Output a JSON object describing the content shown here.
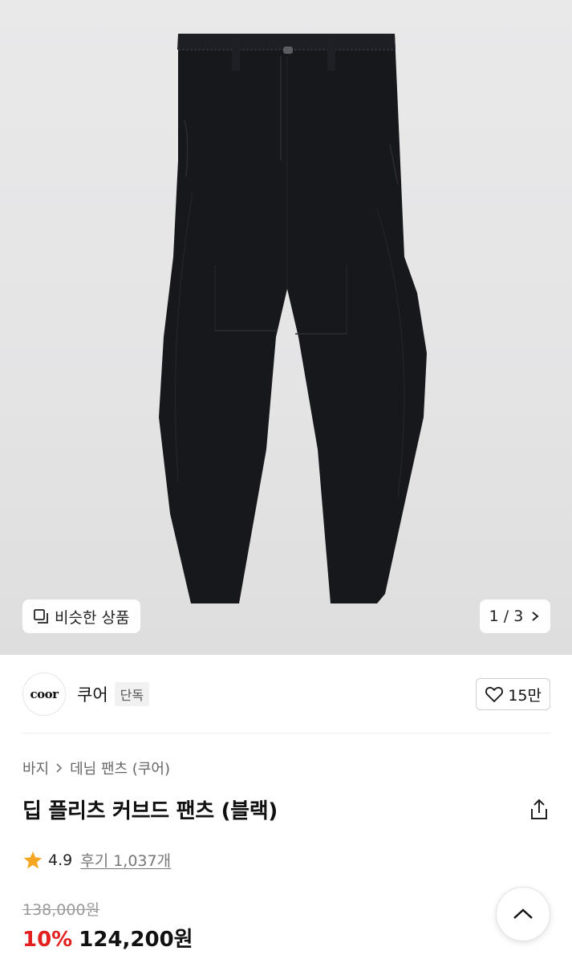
{
  "gallery": {
    "similar_label": "비슷한 상품",
    "current_page": 1,
    "total_pages": 3,
    "pager_text": "1 / 3"
  },
  "brand": {
    "logo_text": "coor",
    "name": "쿠어",
    "badge": "단독",
    "likes": "15만"
  },
  "breadcrumb": [
    "바지",
    "데님 팬츠 (쿠어)"
  ],
  "product": {
    "title": "딥 플리츠 커브드 팬츠 (블랙)",
    "rating": "4.9",
    "reviews": "후기 1,037개",
    "original_price": "138,000원",
    "discount": "10%",
    "sale_price": "124,200원"
  },
  "icons": {
    "similar": "stacked-squares-icon",
    "pager_next": "chevron-right-icon",
    "like": "heart-outline-icon",
    "breadcrumb_sep": "chevron-right-icon",
    "share": "share-icon",
    "rating": "star-icon",
    "scroll_top": "chevron-up-icon"
  },
  "colors": {
    "discount": "#e41f1f",
    "star": "#f5a623",
    "product": "#17181c"
  }
}
